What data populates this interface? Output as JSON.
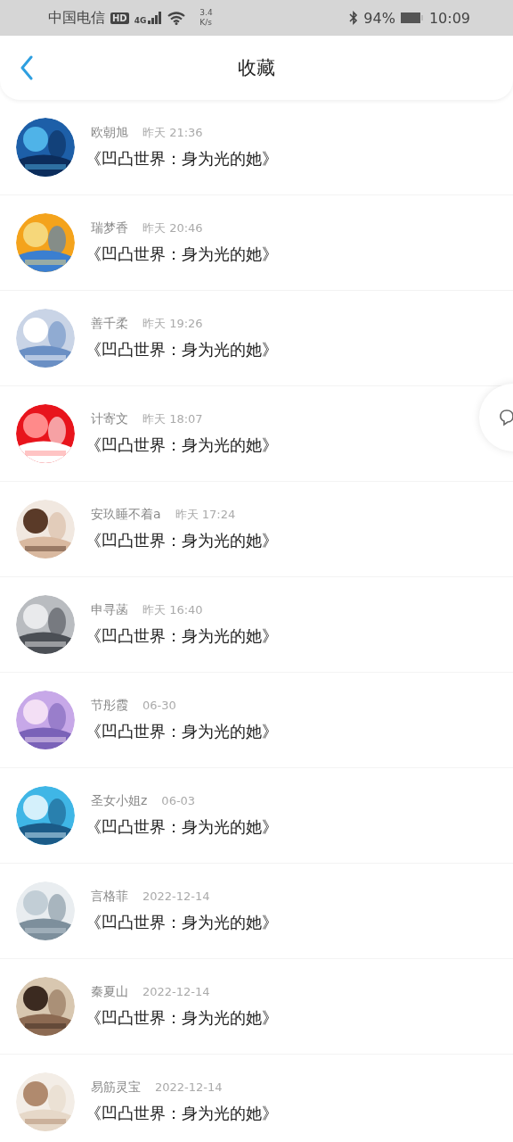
{
  "status_bar": {
    "carrier": "中国电信",
    "hd_badge": "HD",
    "network": "4G",
    "speed_value": "3.4",
    "speed_unit": "K/s",
    "battery": "94%",
    "time": "10:09"
  },
  "header": {
    "title": "收藏"
  },
  "items": [
    {
      "user": "欧朝旭",
      "time": "昨天 21:36",
      "title": "《凹凸世界：身为光的她》"
    },
    {
      "user": "瑞梦香",
      "time": "昨天 20:46",
      "title": "《凹凸世界：身为光的她》"
    },
    {
      "user": "善千柔",
      "time": "昨天 19:26",
      "title": "《凹凸世界：身为光的她》"
    },
    {
      "user": "计寄文",
      "time": "昨天 18:07",
      "title": "《凹凸世界：身为光的她》"
    },
    {
      "user": "安玖睡不着a",
      "time": "昨天 17:24",
      "title": "《凹凸世界：身为光的她》"
    },
    {
      "user": "申寻菡",
      "time": "昨天 16:40",
      "title": "《凹凸世界：身为光的她》"
    },
    {
      "user": "节彤霞",
      "time": "06-30",
      "title": "《凹凸世界：身为光的她》"
    },
    {
      "user": "圣女小姐z",
      "time": "06-03",
      "title": "《凹凸世界：身为光的她》"
    },
    {
      "user": "言格菲",
      "time": "2022-12-14",
      "title": "《凹凸世界：身为光的她》"
    },
    {
      "user": "秦夏山",
      "time": "2022-12-14",
      "title": "《凹凸世界：身为光的她》"
    },
    {
      "user": "易筋灵宝",
      "time": "2022-12-14",
      "title": "《凹凸世界：身为光的她》"
    }
  ]
}
